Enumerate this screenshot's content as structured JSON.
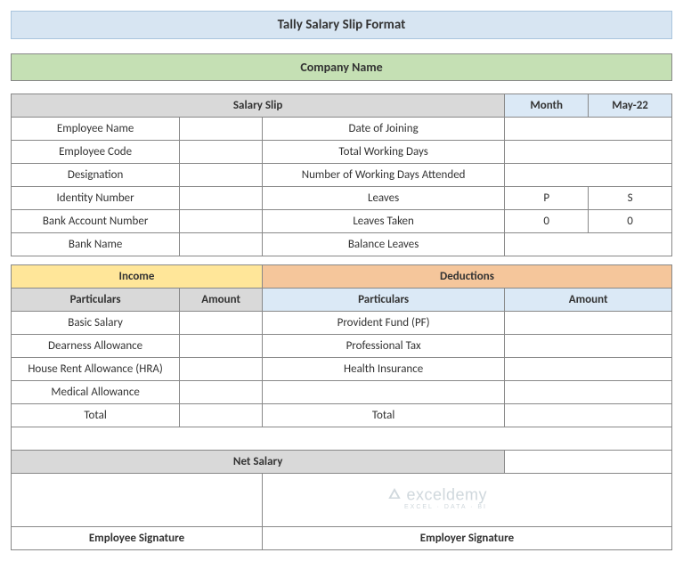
{
  "title": "Tally Salary Slip Format",
  "company": "Company Name",
  "salarySlip": {
    "header": "Salary Slip",
    "monthLabel": "Month",
    "monthValue": "May-22",
    "rows": [
      {
        "left": "Employee Name",
        "leftVal": "",
        "right": "Date of Joining",
        "rightVal1": "",
        "rightVal2": ""
      },
      {
        "left": "Employee Code",
        "leftVal": "",
        "right": "Total Working Days",
        "rightVal1": "",
        "rightVal2": ""
      },
      {
        "left": "Designation",
        "leftVal": "",
        "right": "Number of Working Days Attended",
        "rightVal1": "",
        "rightVal2": ""
      },
      {
        "left": "Identity Number",
        "leftVal": "",
        "right": "Leaves",
        "rightVal1": "P",
        "rightVal2": "S"
      },
      {
        "left": "Bank Account Number",
        "leftVal": "",
        "right": "Leaves Taken",
        "rightVal1": "0",
        "rightVal2": "0"
      },
      {
        "left": "Bank Name",
        "leftVal": "",
        "right": "Balance Leaves",
        "rightVal1": "",
        "rightVal2": ""
      }
    ]
  },
  "incDed": {
    "incomeHeader": "Income",
    "deductionsHeader": "Deductions",
    "particularsLabel": "Particulars",
    "amountLabel": "Amount",
    "rows": [
      {
        "iPart": "Basic Salary",
        "iAmt": "",
        "dPart": "Provident Fund (PF)",
        "dAmt": ""
      },
      {
        "iPart": "Dearness Allowance",
        "iAmt": "",
        "dPart": "Professional Tax",
        "dAmt": ""
      },
      {
        "iPart": "House Rent Allowance (HRA)",
        "iAmt": "",
        "dPart": "Health Insurance",
        "dAmt": ""
      },
      {
        "iPart": "Medical Allowance",
        "iAmt": "",
        "dPart": "",
        "dAmt": ""
      },
      {
        "iPart": "Total",
        "iAmt": "",
        "dPart": "Total",
        "dAmt": ""
      }
    ]
  },
  "netSalary": {
    "label": "Net Salary",
    "value": ""
  },
  "signatures": {
    "employee": "Employee Signature",
    "employer": "Employer Signature"
  },
  "watermark": {
    "main": "exceldemy",
    "sub": "EXCEL · DATA · BI"
  }
}
